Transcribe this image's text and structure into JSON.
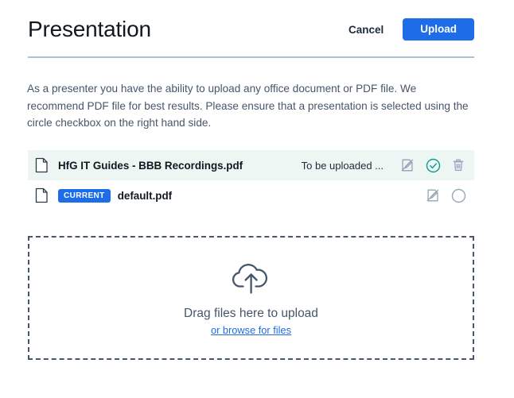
{
  "header": {
    "title": "Presentation",
    "cancel_label": "Cancel",
    "upload_label": "Upload"
  },
  "intro": {
    "text": "As a presenter you have the ability to upload any office document or PDF file. We recommend PDF file for best results. Please ensure that a presentation is selected using the circle checkbox on the right hand side."
  },
  "files": [
    {
      "name": "HfG IT Guides - BBB Recordings.pdf",
      "status": "To be uploaded ...",
      "badge": "",
      "selected": true,
      "icons": [
        "edit-disabled-icon",
        "check-circle-icon",
        "trash-icon"
      ]
    },
    {
      "name": "default.pdf",
      "status": "",
      "badge": "CURRENT",
      "selected": false,
      "icons": [
        "edit-disabled-icon",
        "radio-unselected-icon"
      ]
    }
  ],
  "dropzone": {
    "icon": "cloud-upload-icon",
    "title": "Drag files here to upload",
    "link": "or browse for files"
  },
  "colors": {
    "accent_blue": "#1d6ce8",
    "teal": "#0e9b96",
    "icon_gray": "#8f a0b3",
    "text_dark": "#111820",
    "text_muted": "#46566a",
    "row_selected_bg": "#eef6f4",
    "rule": "#b2bfcd"
  }
}
